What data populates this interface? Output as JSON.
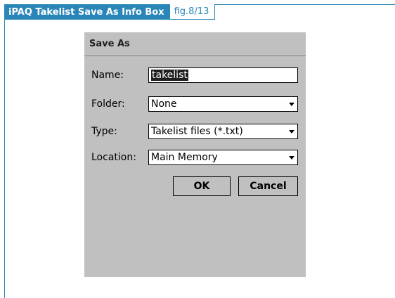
{
  "figure": {
    "title": "iPAQ Takelist Save As Info Box",
    "number": "fig.8/13",
    "accent_color": "#2a86b8"
  },
  "dialog": {
    "title": "Save As",
    "name": {
      "label": "Name:",
      "value": "takelist"
    },
    "folder": {
      "label": "Folder:",
      "value": "None"
    },
    "type": {
      "label": "Type:",
      "value": "Takelist files (*.txt)"
    },
    "location": {
      "label": "Location:",
      "value": "Main Memory"
    },
    "ok_label": "OK",
    "cancel_label": "Cancel",
    "background_color": "#c0c0c0"
  }
}
